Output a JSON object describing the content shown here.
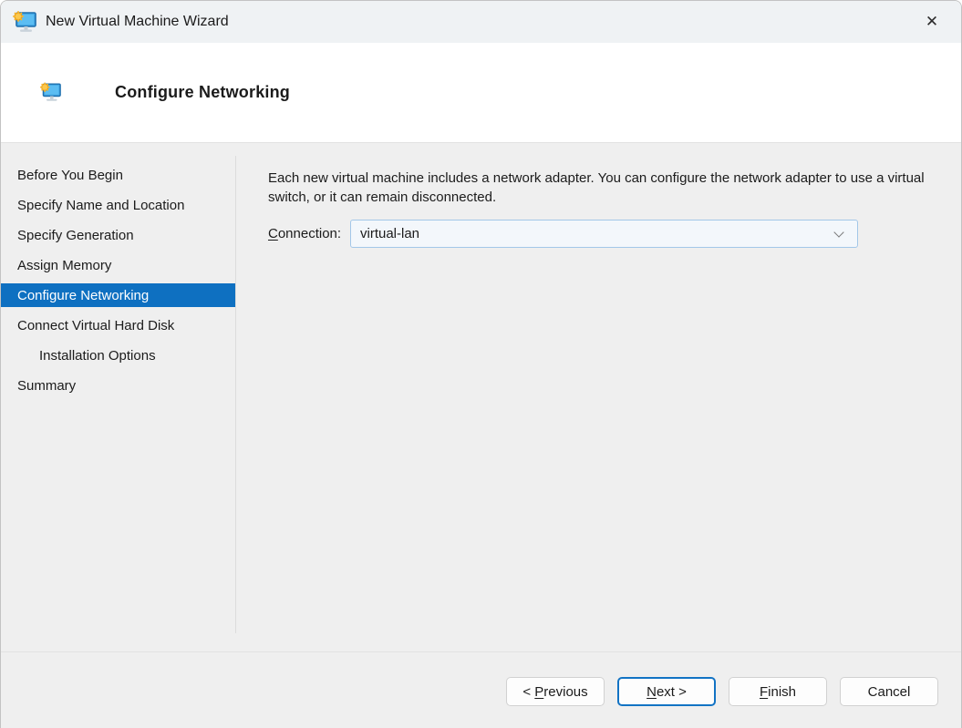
{
  "window": {
    "title": "New Virtual Machine Wizard",
    "close_glyph": "✕"
  },
  "header": {
    "title": "Configure Networking"
  },
  "sidebar": {
    "items": [
      {
        "label": "Before You Begin",
        "selected": false,
        "indented": false
      },
      {
        "label": "Specify Name and Location",
        "selected": false,
        "indented": false
      },
      {
        "label": "Specify Generation",
        "selected": false,
        "indented": false
      },
      {
        "label": "Assign Memory",
        "selected": false,
        "indented": false
      },
      {
        "label": "Configure Networking",
        "selected": true,
        "indented": false
      },
      {
        "label": "Connect Virtual Hard Disk",
        "selected": false,
        "indented": false
      },
      {
        "label": "Installation Options",
        "selected": false,
        "indented": true
      },
      {
        "label": "Summary",
        "selected": false,
        "indented": false
      }
    ]
  },
  "content": {
    "description": "Each new virtual machine includes a network adapter. You can configure the network adapter to use a virtual switch, or it can remain disconnected.",
    "connection_label": {
      "key": "C",
      "rest": "onnection:"
    },
    "connection_value": "virtual-lan"
  },
  "footer": {
    "buttons": [
      {
        "pre": "< ",
        "key": "P",
        "rest": "revious",
        "default": false
      },
      {
        "pre": "",
        "key": "N",
        "rest": "ext >",
        "default": true
      },
      {
        "pre": "",
        "key": "F",
        "rest": "inish",
        "default": false
      },
      {
        "pre": "",
        "key": "",
        "rest": "Cancel",
        "default": false
      }
    ]
  },
  "colors": {
    "accent": "#0e70c1",
    "selected_item_bg": "#0e70c1",
    "selected_item_text": "#ffffff",
    "default_button_border": "#1273c4",
    "combobox_border": "#a3c7e8",
    "combobox_bg": "#f3f7fb",
    "titlebar_bg": "#eff2f4",
    "body_bg": "#efefef"
  }
}
